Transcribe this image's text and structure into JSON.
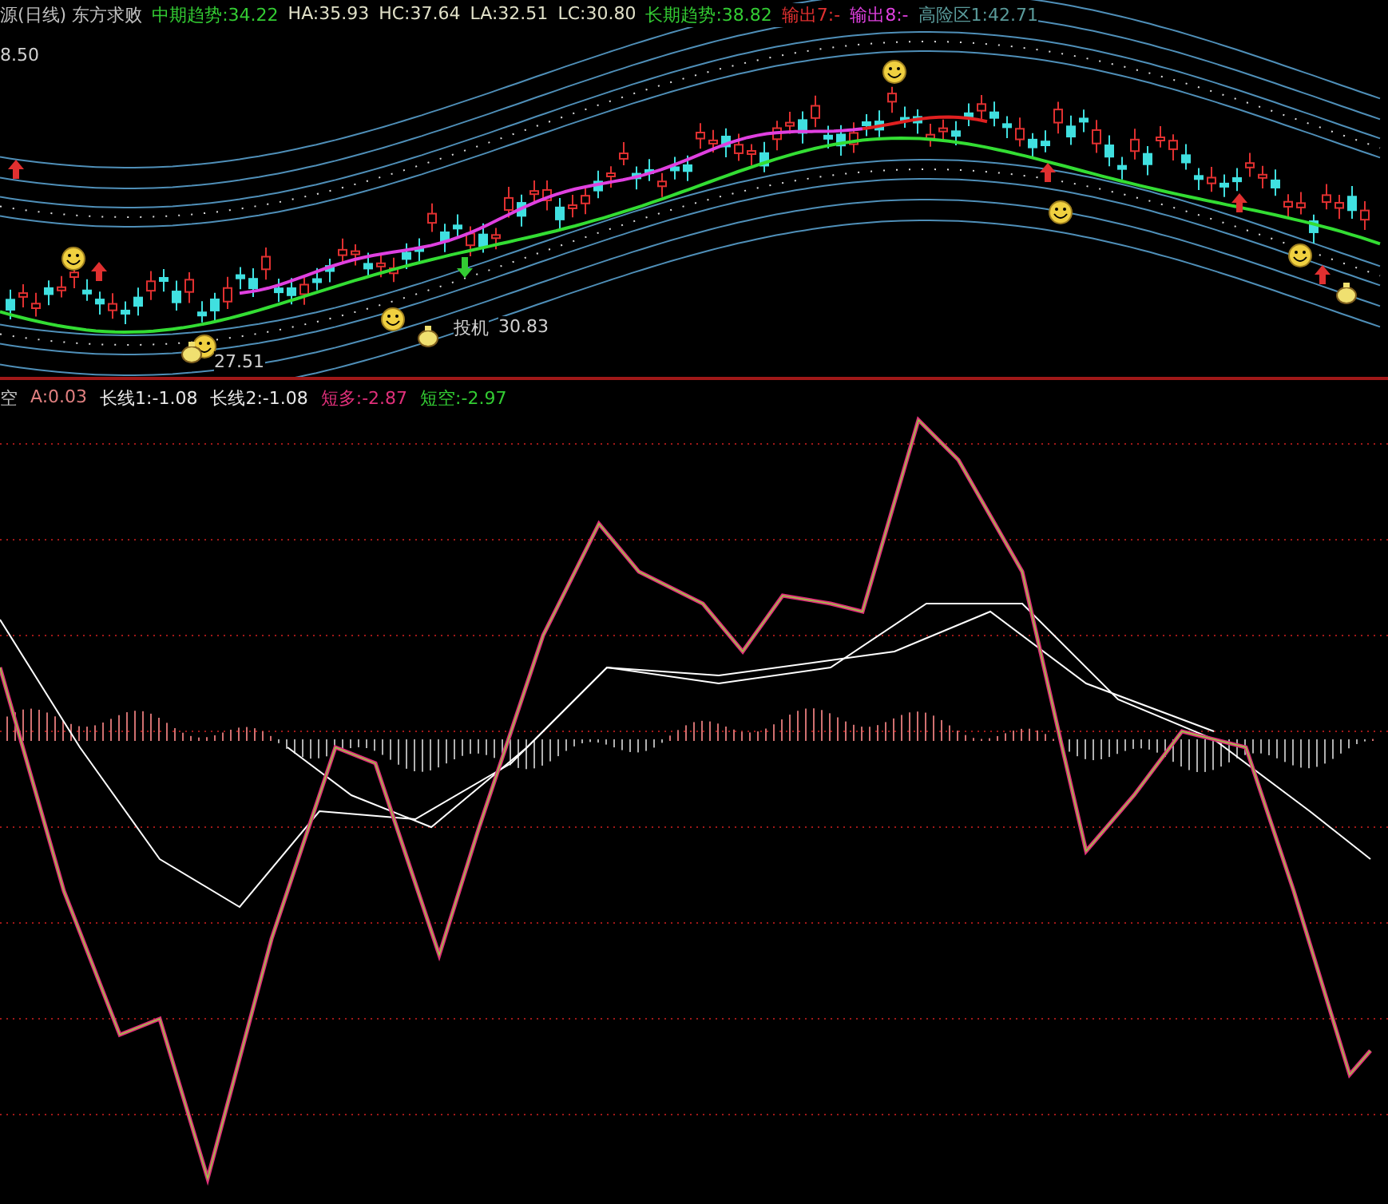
{
  "upper_panel": {
    "legend": [
      {
        "text": "源(日线) 东方求败",
        "color": "#c0c0c0"
      },
      {
        "text": "中期趋势:34.22",
        "color": "#33cc33"
      },
      {
        "text": "HA:35.93",
        "color": "#e0e0c8"
      },
      {
        "text": "HC:37.64",
        "color": "#e0e0c8"
      },
      {
        "text": "LA:32.51",
        "color": "#e0e0c8"
      },
      {
        "text": "LC:30.80",
        "color": "#e0e0c8"
      },
      {
        "text": "长期趋势:38.82",
        "color": "#33cc33"
      },
      {
        "text": "输出7:-",
        "color": "#e03030"
      },
      {
        "text": "输出8:-",
        "color": "#e040e0"
      },
      {
        "text": "高险区1:42.71",
        "color": "#5a9a9a"
      }
    ],
    "price_label": "8.50",
    "low_label": "27.51",
    "signal_label": "投机",
    "signal_value": "30.83"
  },
  "lower_panel": {
    "legend": [
      {
        "text": "空",
        "color": "#c0c0c0"
      },
      {
        "text": "A:0.03",
        "color": "#e08080"
      },
      {
        "text": "长线1:-1.08",
        "color": "#e8e8e8"
      },
      {
        "text": "长线2:-1.08",
        "color": "#e8e8e8"
      },
      {
        "text": "短多:-2.87",
        "color": "#e0307a"
      },
      {
        "text": "短空:-2.97",
        "color": "#33cc33"
      }
    ]
  }
}
